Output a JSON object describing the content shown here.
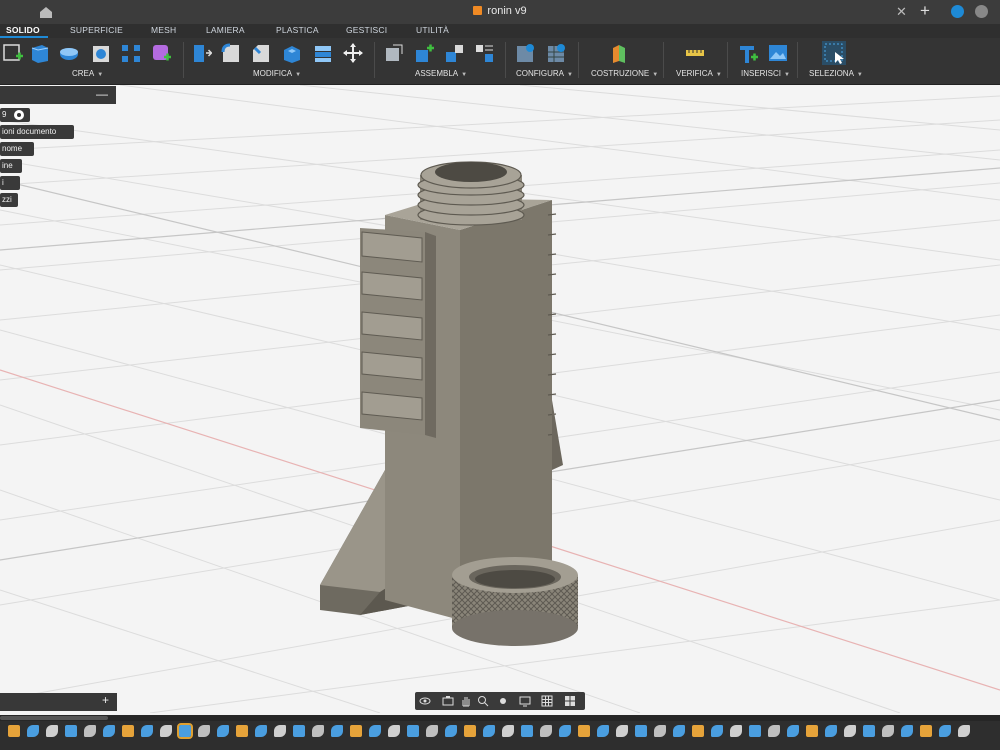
{
  "window": {
    "title": "ronin v9"
  },
  "tabs": [
    "SOLIDO",
    "SUPERFICIE",
    "MESH",
    "LAMIERA",
    "PLASTICA",
    "GESTISCI",
    "UTILITÀ"
  ],
  "ribbon": {
    "groups": [
      "CREA",
      "MODIFICA",
      "ASSEMBLA",
      "CONFIGURA",
      "COSTRUZIONE",
      "VERIFICA",
      "INSERISCI",
      "SELEZIONA"
    ]
  },
  "browser": {
    "rows": [
      "9",
      "ioni documento",
      "nome",
      "ine",
      "i",
      "zzi"
    ]
  },
  "colors": {
    "ribbon_bg": "#343434",
    "accent": "#1e8ad6",
    "model": "#878275"
  },
  "icons": [
    "home-icon",
    "close-icon",
    "plus-icon",
    "orbit-icon",
    "pan-icon",
    "zoom-icon",
    "display-settings-icon",
    "grid-icon",
    "viewports-icon"
  ]
}
